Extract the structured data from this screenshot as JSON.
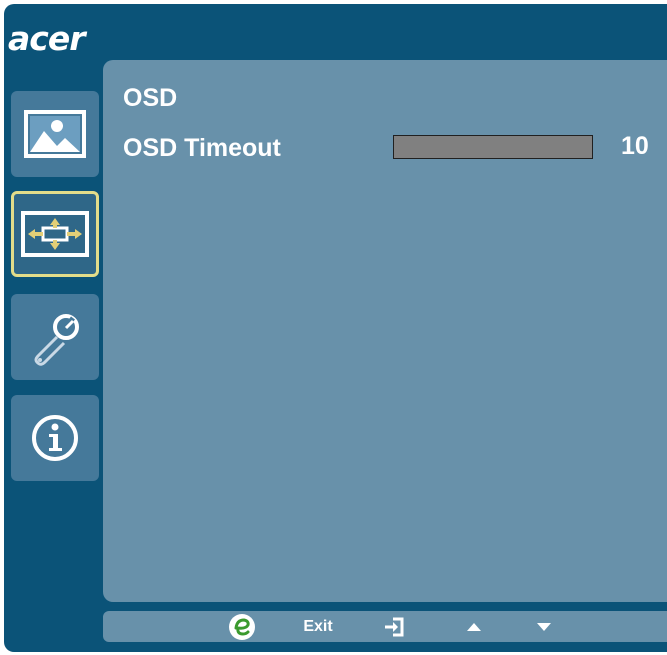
{
  "brand": {
    "logo": "acer"
  },
  "sidebar": {
    "items": [
      {
        "name": "picture",
        "icon": "picture-icon",
        "selected": false
      },
      {
        "name": "osd",
        "icon": "osd-position-icon",
        "selected": true
      },
      {
        "name": "settings",
        "icon": "wrench-icon",
        "selected": false
      },
      {
        "name": "information",
        "icon": "info-icon",
        "selected": false
      }
    ]
  },
  "main": {
    "title": "OSD",
    "rows": [
      {
        "label": "OSD Timeout",
        "value": "10"
      }
    ]
  },
  "footer": {
    "buttons": [
      {
        "icon": "empowering-e-icon"
      },
      {
        "label": "Exit"
      },
      {
        "icon": "enter-icon"
      },
      {
        "icon": "up-arrow-icon"
      },
      {
        "icon": "down-arrow-icon"
      }
    ]
  },
  "colors": {
    "frame": "#0b5378",
    "panel": "#6891aa",
    "sidebar_button": "#45799a",
    "selection_border": "#e3dd8a",
    "slider": "#808080",
    "e_logo": "#3b9a2e"
  }
}
